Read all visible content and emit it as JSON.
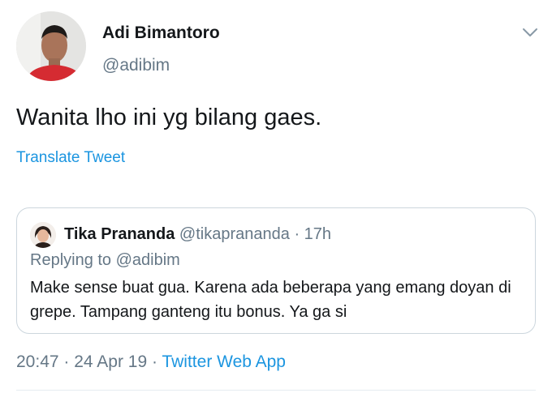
{
  "author": {
    "display_name": "Adi Bimantoro",
    "handle": "@adibim"
  },
  "tweet": {
    "text": "Wanita lho ini yg bilang gaes.",
    "translate_label": "Translate Tweet"
  },
  "quoted_tweet": {
    "display_name": "Tika Prananda",
    "handle": "@tikaprananda",
    "separator": "·",
    "time": "17h",
    "replying_prefix": "Replying to",
    "replying_handle": "@adibim",
    "text": "Make sense buat gua. Karena ada beberapa yang emang doyan di grepe. Tampang ganteng itu bonus. Ya ga si"
  },
  "meta": {
    "time": "20:47",
    "separator": "·",
    "date": "24 Apr 19",
    "source": "Twitter Web App"
  },
  "icons": {
    "menu": "chevron-down-icon"
  },
  "colors": {
    "link": "#1b95e0",
    "secondary_text": "#657786",
    "primary_text": "#14171a",
    "border": "#ccd6dd"
  }
}
